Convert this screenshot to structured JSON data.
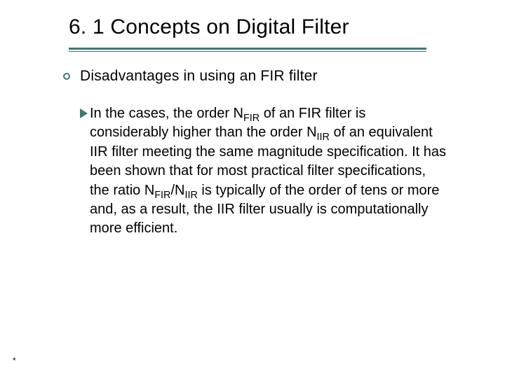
{
  "title": "6. 1 Concepts on Digital Filter",
  "subheading": "Disadvantages in using an FIR filter",
  "body": {
    "pre1": "In the cases, the order N",
    "sub1": "FIR",
    "mid1": " of an FIR filter is considerably higher than the order N",
    "sub2": "IIR",
    "mid2": " of an equivalent IIR filter meeting the same magnitude specification. It has been shown that for most practical filter specifications, the ratio N",
    "sub3": "FIR",
    "mid3": "/N",
    "sub4": "IIR",
    "post": " is typically of the order of tens or more and,  as a result, the IIR filter usually is computationally more efficient."
  },
  "footnote": "*"
}
